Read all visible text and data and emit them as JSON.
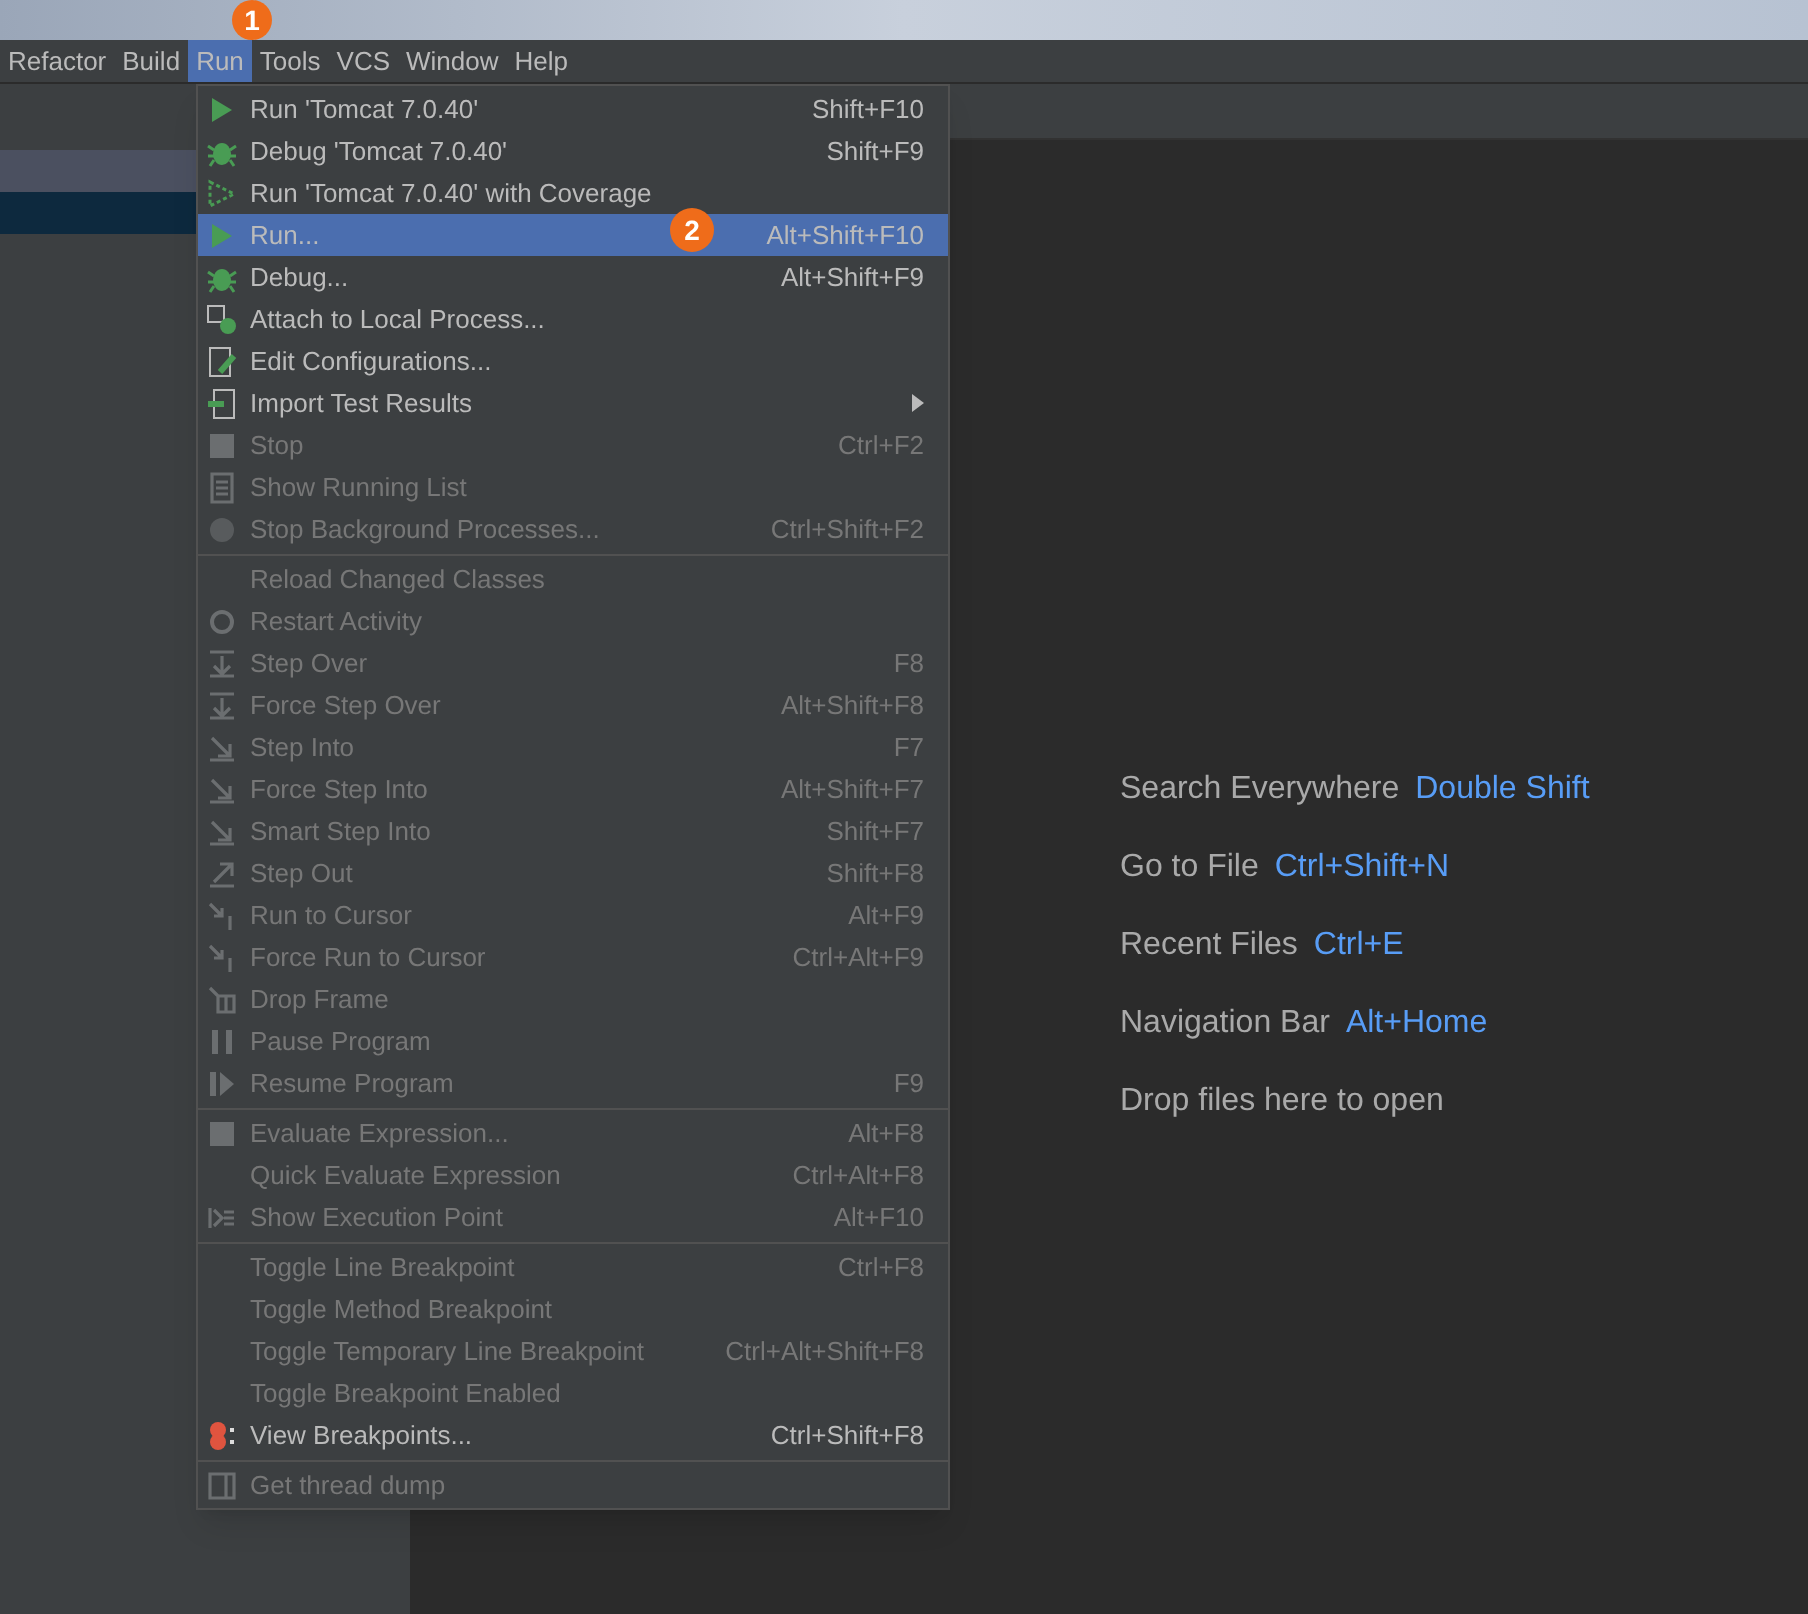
{
  "menu_bar": [
    {
      "label": "Refactor",
      "selected": false
    },
    {
      "label": "Build",
      "selected": false
    },
    {
      "label": "Run",
      "selected": true
    },
    {
      "label": "Tools",
      "selected": false
    },
    {
      "label": "VCS",
      "selected": false
    },
    {
      "label": "Window",
      "selected": false
    },
    {
      "label": "Help",
      "selected": false
    }
  ],
  "step_badges": [
    {
      "label": "1"
    },
    {
      "label": "2"
    }
  ],
  "run_menu": [
    {
      "kind": "item",
      "label": "Run 'Tomcat 7.0.40'",
      "shortcut": "Shift+F10",
      "disabled": false,
      "selected": false
    },
    {
      "kind": "item",
      "label": "Debug 'Tomcat 7.0.40'",
      "shortcut": "Shift+F9",
      "disabled": false,
      "selected": false
    },
    {
      "kind": "item",
      "label": "Run 'Tomcat 7.0.40' with Coverage",
      "disabled": false,
      "selected": false
    },
    {
      "kind": "item",
      "label": "Run...",
      "shortcut": "Alt+Shift+F10",
      "disabled": false,
      "selected": true
    },
    {
      "kind": "item",
      "label": "Debug...",
      "shortcut": "Alt+Shift+F9",
      "disabled": false,
      "selected": false
    },
    {
      "kind": "item",
      "label": "Attach to Local Process...",
      "disabled": false,
      "selected": false
    },
    {
      "kind": "item",
      "label": "Edit Configurations...",
      "disabled": false,
      "selected": false
    },
    {
      "kind": "submenu",
      "label": "Import Test Results",
      "disabled": false,
      "selected": false
    },
    {
      "kind": "item",
      "label": "Stop",
      "shortcut": "Ctrl+F2",
      "disabled": true,
      "selected": false
    },
    {
      "kind": "item",
      "label": "Show Running List",
      "disabled": true,
      "selected": false
    },
    {
      "kind": "item",
      "label": "Stop Background Processes...",
      "shortcut": "Ctrl+Shift+F2",
      "disabled": true,
      "selected": false
    },
    {
      "kind": "separator"
    },
    {
      "kind": "item",
      "label": "Reload Changed Classes",
      "disabled": true,
      "selected": false
    },
    {
      "kind": "item",
      "label": "Restart Activity",
      "disabled": true,
      "selected": false
    },
    {
      "kind": "item",
      "label": "Step Over",
      "shortcut": "F8",
      "disabled": true,
      "selected": false
    },
    {
      "kind": "item",
      "label": "Force Step Over",
      "shortcut": "Alt+Shift+F8",
      "disabled": true,
      "selected": false
    },
    {
      "kind": "item",
      "label": "Step Into",
      "shortcut": "F7",
      "disabled": true,
      "selected": false
    },
    {
      "kind": "item",
      "label": "Force Step Into",
      "shortcut": "Alt+Shift+F7",
      "disabled": true,
      "selected": false
    },
    {
      "kind": "item",
      "label": "Smart Step Into",
      "shortcut": "Shift+F7",
      "disabled": true,
      "selected": false
    },
    {
      "kind": "item",
      "label": "Step Out",
      "shortcut": "Shift+F8",
      "disabled": true,
      "selected": false
    },
    {
      "kind": "item",
      "label": "Run to Cursor",
      "shortcut": "Alt+F9",
      "disabled": true,
      "selected": false
    },
    {
      "kind": "item",
      "label": "Force Run to Cursor",
      "shortcut": "Ctrl+Alt+F9",
      "disabled": true,
      "selected": false
    },
    {
      "kind": "item",
      "label": "Drop Frame",
      "disabled": true,
      "selected": false
    },
    {
      "kind": "item",
      "label": "Pause Program",
      "disabled": true,
      "selected": false
    },
    {
      "kind": "item",
      "label": "Resume Program",
      "shortcut": "F9",
      "disabled": true,
      "selected": false
    },
    {
      "kind": "separator"
    },
    {
      "kind": "item",
      "label": "Evaluate Expression...",
      "shortcut": "Alt+F8",
      "disabled": true,
      "selected": false
    },
    {
      "kind": "item",
      "label": "Quick Evaluate Expression",
      "shortcut": "Ctrl+Alt+F8",
      "disabled": true,
      "selected": false
    },
    {
      "kind": "item",
      "label": "Show Execution Point",
      "shortcut": "Alt+F10",
      "disabled": true,
      "selected": false
    },
    {
      "kind": "separator"
    },
    {
      "kind": "item",
      "label": "Toggle Line Breakpoint",
      "shortcut": "Ctrl+F8",
      "disabled": true,
      "selected": false
    },
    {
      "kind": "item",
      "label": "Toggle Method Breakpoint",
      "disabled": true,
      "selected": false
    },
    {
      "kind": "item",
      "label": "Toggle Temporary Line Breakpoint",
      "shortcut": "Ctrl+Alt+Shift+F8",
      "disabled": true,
      "selected": false
    },
    {
      "kind": "item",
      "label": "Toggle Breakpoint Enabled",
      "disabled": true,
      "selected": false
    },
    {
      "kind": "item",
      "label": "View Breakpoints...",
      "shortcut": "Ctrl+Shift+F8",
      "disabled": false,
      "selected": false
    },
    {
      "kind": "separator"
    },
    {
      "kind": "item",
      "label": "Get thread dump",
      "disabled": true,
      "selected": false
    }
  ],
  "welcome_hints": [
    {
      "label": "Search Everywhere",
      "shortcut": "Double Shift"
    },
    {
      "label": "Go to File",
      "shortcut": "Ctrl+Shift+N"
    },
    {
      "label": "Recent Files",
      "shortcut": "Ctrl+E"
    },
    {
      "label": "Navigation Bar",
      "shortcut": "Alt+Home"
    },
    {
      "label": "Drop files here to open"
    }
  ]
}
